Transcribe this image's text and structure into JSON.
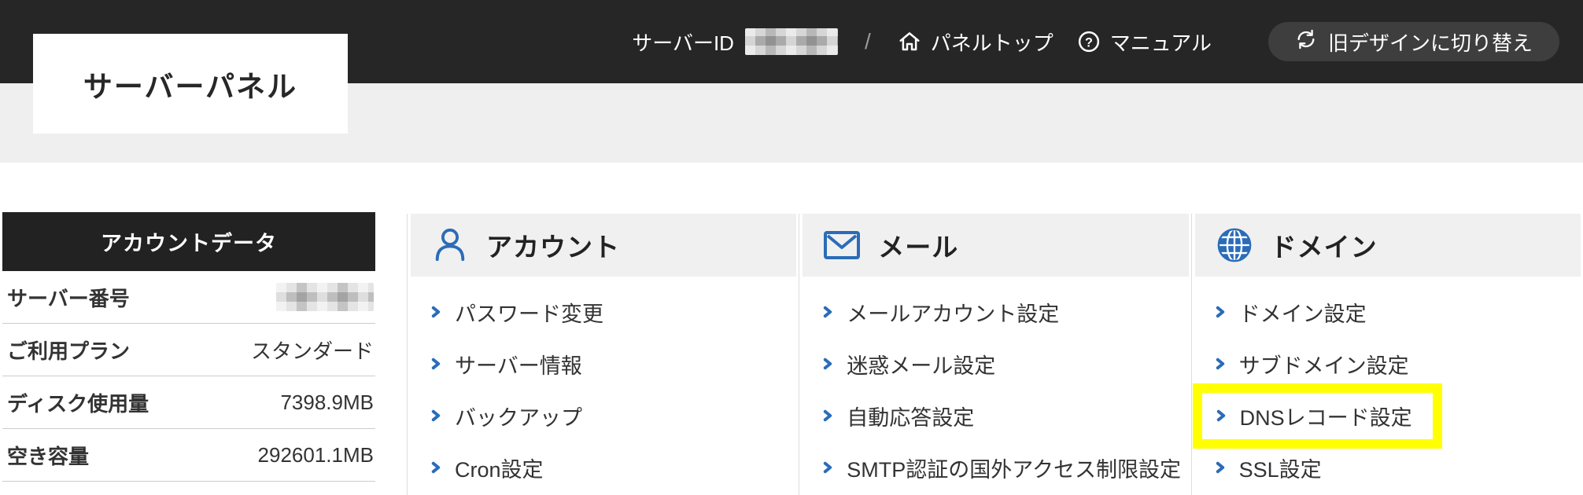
{
  "header": {
    "logo": "サーバーパネル",
    "server_id_label": "サーバーID",
    "server_id_value_masked": true,
    "separator": "/",
    "nav": [
      {
        "label": "パネルトップ",
        "icon": "home-icon"
      },
      {
        "label": "マニュアル",
        "icon": "help-icon"
      }
    ],
    "switch_button": {
      "label": "旧デザインに切り替え",
      "icon": "switch-design-icon"
    }
  },
  "sidebar": {
    "title": "アカウントデータ",
    "rows": [
      {
        "label": "サーバー番号",
        "value": "",
        "masked": true
      },
      {
        "label": "ご利用プラン",
        "value": "スタンダード",
        "masked": false
      },
      {
        "label": "ディスク使用量",
        "value": "7398.9MB",
        "masked": false
      },
      {
        "label": "空き容量",
        "value": "292601.1MB",
        "masked": false
      }
    ]
  },
  "menu": {
    "columns": [
      {
        "title": "アカウント",
        "icon": "user-icon",
        "links": [
          "パスワード変更",
          "サーバー情報",
          "バックアップ",
          "Cron設定"
        ]
      },
      {
        "title": "メール",
        "icon": "mail-icon",
        "links": [
          "メールアカウント設定",
          "迷惑メール設定",
          "自動応答設定",
          "SMTP認証の国外アクセス制限設定"
        ]
      },
      {
        "title": "ドメイン",
        "icon": "globe-icon",
        "links": [
          "ドメイン設定",
          "サブドメイン設定",
          "DNSレコード設定",
          "SSL設定"
        ],
        "highlighted": "DNSレコード設定"
      }
    ]
  },
  "colors": {
    "topbar_bg": "#262626",
    "band_bg": "#efefef",
    "sidebar_header_bg": "#222222",
    "column_header_bg": "#f0f0f0",
    "accent_blue": "#2b6cb8",
    "highlight_yellow": "#ffff00",
    "link_text": "#333333"
  }
}
